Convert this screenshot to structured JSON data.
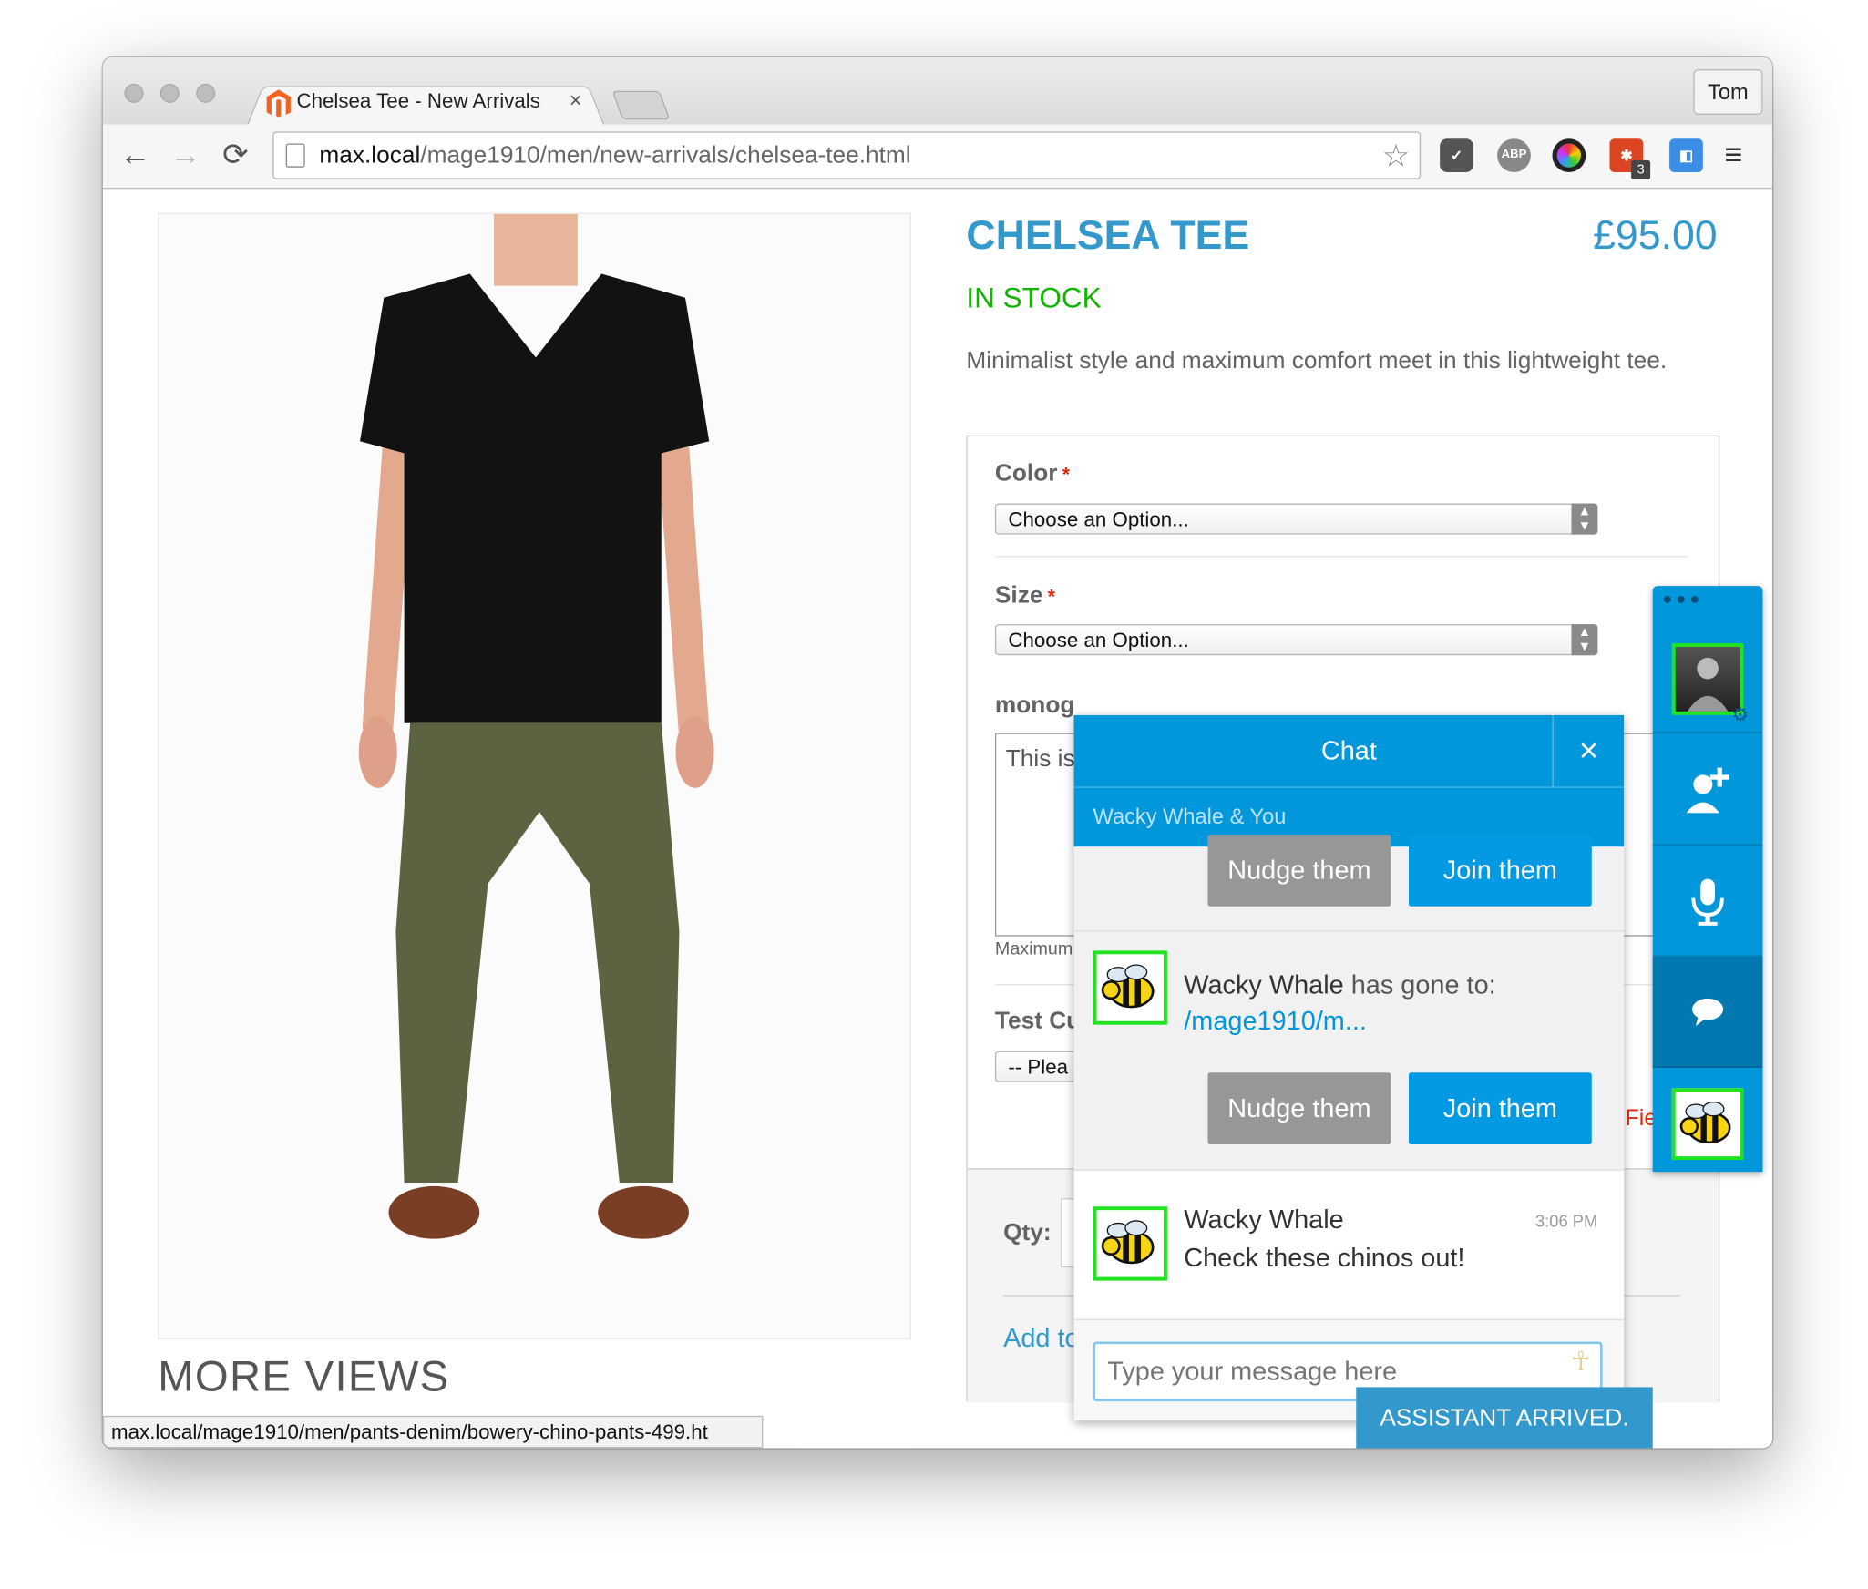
{
  "browser": {
    "tab_title": "Chelsea Tee - New Arrivals",
    "tab_close": "×",
    "profile": "Tom",
    "url_host": "max.local",
    "url_path": "/mage1910/men/new-arrivals/chelsea-tee.html",
    "status_url": "max.local/mage1910/men/pants-denim/bowery-chino-pants-499.ht",
    "back": "←",
    "forward": "→",
    "reload": "⟳",
    "star": "☆",
    "menu": "≡",
    "ext_abp": "ABP",
    "ext_badge": "3"
  },
  "product": {
    "title": "CHELSEA TEE",
    "price": "£95.00",
    "stock": "IN STOCK",
    "description": "Minimalist style and maximum comfort meet in this lightweight tee.",
    "more_views": "MORE VIEWS",
    "options": {
      "color_label": "Color",
      "size_label": "Size",
      "required_mark": "*",
      "select_placeholder": "Choose an Option...",
      "monogram_label": "monog",
      "monogram_value": "This is",
      "maximum_note": "Maximum",
      "test_label": "Test Cu",
      "test_select": "-- Plea",
      "field_error": "Fie",
      "qty_label": "Qty:",
      "add_to": "Add to"
    }
  },
  "chat": {
    "header": "Chat",
    "close": "×",
    "subheader": "Wacky Whale & You",
    "nudge_label": "Nudge them",
    "join_label": "Join them",
    "events": [
      {
        "name": "Wacky Whale",
        "text": "has gone to:",
        "link": "/mage1910/m..."
      }
    ],
    "messages": [
      {
        "name": "Wacky Whale",
        "time": "3:06 PM",
        "text": "Check these chinos out!"
      }
    ],
    "input_placeholder": "Type your message here",
    "input_icon": "☥"
  },
  "assistant_banner": "ASSISTANT ARRIVED.",
  "colors": {
    "accent": "#3399cc",
    "chat_blue": "#0296da",
    "in_stock": "#11b400",
    "avatar_border": "#21e321"
  },
  "icons": [
    "back-icon",
    "forward-icon",
    "reload-icon",
    "page-icon",
    "bookmark-star-icon",
    "pocket-icon",
    "adblock-icon",
    "color-picker-icon",
    "lastpass-icon",
    "extension-icon",
    "menu-icon",
    "add-user-icon",
    "microphone-icon",
    "chat-bubble-icon",
    "settings-gear-icon",
    "send-icon"
  ]
}
